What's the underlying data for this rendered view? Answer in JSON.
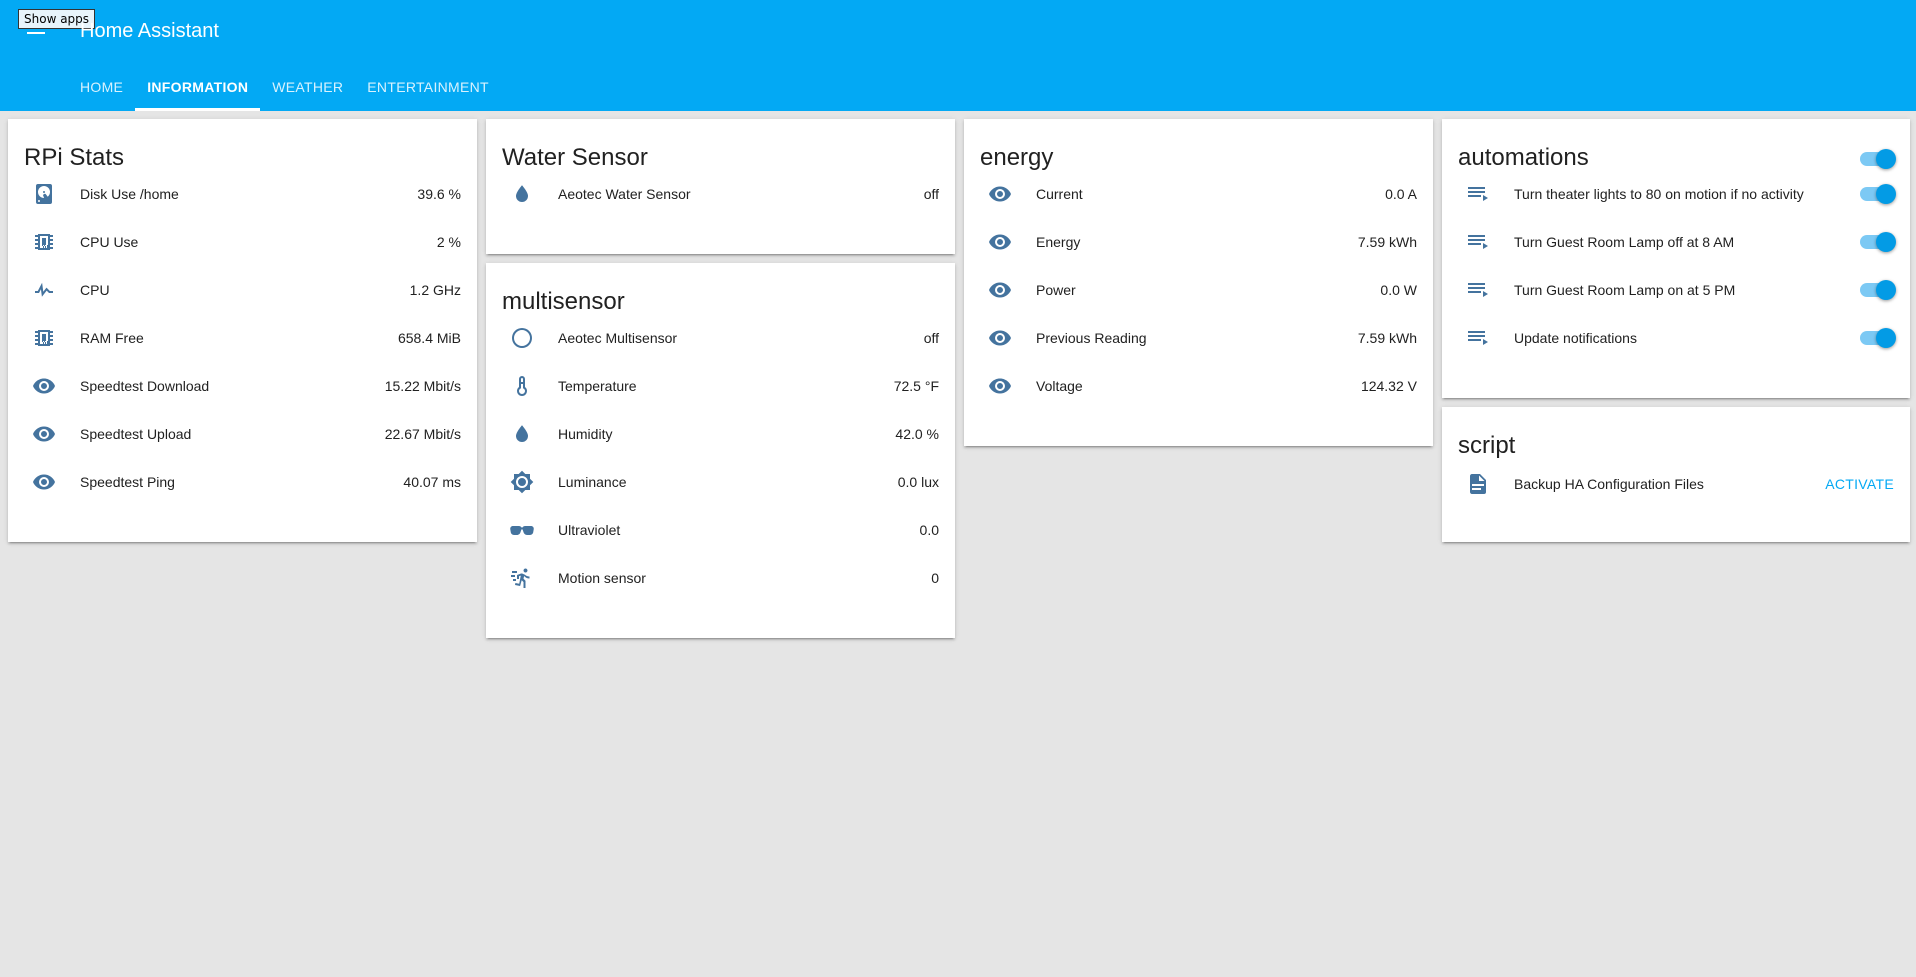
{
  "app": {
    "title": "Home Assistant",
    "tooltip": "Show apps"
  },
  "tabs": [
    {
      "label": "HOME"
    },
    {
      "label": "INFORMATION"
    },
    {
      "label": "WEATHER"
    },
    {
      "label": "ENTERTAINMENT"
    }
  ],
  "cards": {
    "rpi": {
      "title": "RPi Stats",
      "rows": [
        {
          "icon": "harddisk-icon",
          "label": "Disk Use /home",
          "value": "39.6 %"
        },
        {
          "icon": "chip-icon",
          "label": "CPU Use",
          "value": "2 %"
        },
        {
          "icon": "pulse-icon",
          "label": "CPU",
          "value": "1.2 GHz"
        },
        {
          "icon": "chip-icon",
          "label": "RAM Free",
          "value": "658.4 MiB"
        },
        {
          "icon": "eye-icon",
          "label": "Speedtest Download",
          "value": "15.22 Mbit/s"
        },
        {
          "icon": "eye-icon",
          "label": "Speedtest Upload",
          "value": "22.67 Mbit/s"
        },
        {
          "icon": "eye-icon",
          "label": "Speedtest Ping",
          "value": "40.07 ms"
        }
      ]
    },
    "water": {
      "title": "Water Sensor",
      "rows": [
        {
          "icon": "water-drop-icon",
          "label": "Aeotec Water Sensor",
          "value": "off"
        }
      ]
    },
    "multisensor": {
      "title": "multisensor",
      "rows": [
        {
          "icon": "circle-outline-icon",
          "label": "Aeotec Multisensor",
          "value": "off"
        },
        {
          "icon": "thermometer-icon",
          "label": "Temperature",
          "value": "72.5 °F"
        },
        {
          "icon": "water-drop-icon",
          "label": "Humidity",
          "value": "42.0 %"
        },
        {
          "icon": "brightness-icon",
          "label": "Luminance",
          "value": "0.0 lux"
        },
        {
          "icon": "sunglasses-icon",
          "label": "Ultraviolet",
          "value": "0.0"
        },
        {
          "icon": "run-icon",
          "label": "Motion sensor",
          "value": "0"
        }
      ]
    },
    "energy": {
      "title": "energy",
      "rows": [
        {
          "icon": "eye-icon",
          "label": "Current",
          "value": "0.0 A"
        },
        {
          "icon": "eye-icon",
          "label": "Energy",
          "value": "7.59 kWh"
        },
        {
          "icon": "eye-icon",
          "label": "Power",
          "value": "0.0 W"
        },
        {
          "icon": "eye-icon",
          "label": "Previous Reading",
          "value": "7.59 kWh"
        },
        {
          "icon": "eye-icon",
          "label": "Voltage",
          "value": "124.32 V"
        }
      ]
    },
    "automations": {
      "title": "automations",
      "header_toggle_on": true,
      "rows": [
        {
          "icon": "playlist-play-icon",
          "label": "Turn theater lights to 80 on motion if no activity",
          "on": true
        },
        {
          "icon": "playlist-play-icon",
          "label": "Turn Guest Room Lamp off at 8 AM",
          "on": true
        },
        {
          "icon": "playlist-play-icon",
          "label": "Turn Guest Room Lamp on at 5 PM",
          "on": true
        },
        {
          "icon": "playlist-play-icon",
          "label": "Update notifications",
          "on": true
        }
      ]
    },
    "script": {
      "title": "script",
      "rows": [
        {
          "icon": "file-document-icon",
          "label": "Backup HA Configuration Files",
          "action": "ACTIVATE"
        }
      ]
    }
  },
  "colors": {
    "header": "#03a9f4",
    "icon": "#44739e",
    "toggle_on": "#039be5",
    "background": "#e5e5e5"
  }
}
